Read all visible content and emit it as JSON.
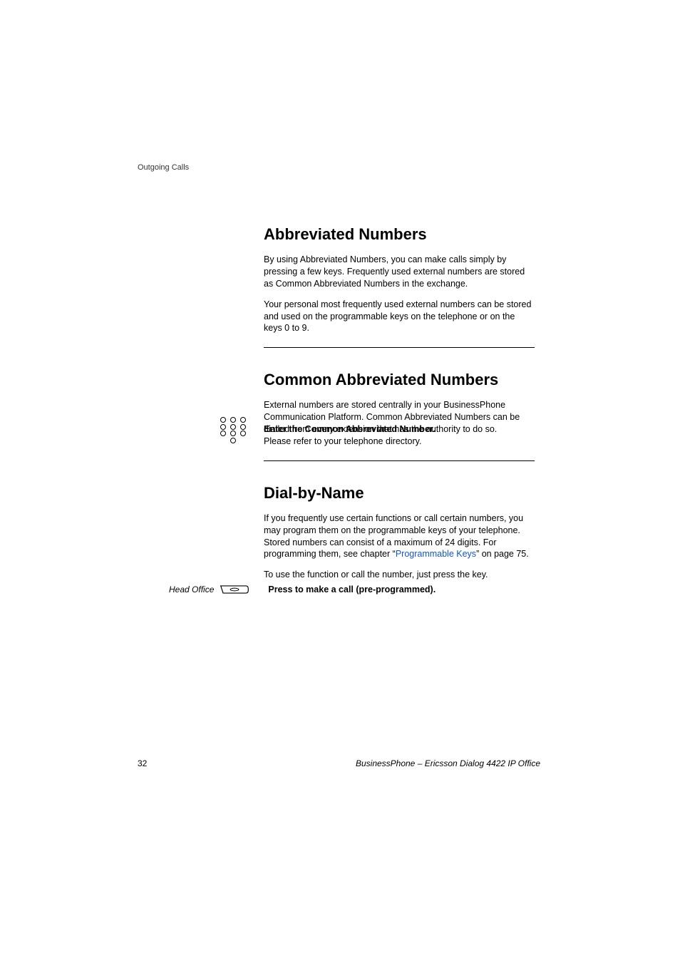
{
  "header": {
    "section_name": "Outgoing Calls"
  },
  "section1": {
    "heading": "Abbreviated Numbers",
    "para1": "By using Abbreviated Numbers, you can make calls simply by pressing a few keys. Frequently used external numbers are stored as Common Abbreviated Numbers in the exchange.",
    "para2": "Your personal most frequently used external numbers can be stored and used on the programmable keys on the telephone or on the keys 0 to 9."
  },
  "section2": {
    "heading": "Common Abbreviated Numbers",
    "para1": "External numbers are stored centrally in your BusinessPhone Communication Platform. Common Abbreviated Numbers can be dialled from every extension that has the authority to do so.",
    "bold_line": "Enter the Common Abbreviated Number.",
    "sub_line": "Please refer to your telephone directory."
  },
  "section3": {
    "heading": "Dial-by-Name",
    "para1_a": "If you frequently use certain functions or call certain numbers, you may program them on the programmable keys of your telephone. Stored numbers can consist of a maximum of 24 digits. For programming them, see chapter “",
    "para1_link": "Programmable Keys",
    "para1_b": "” on page 75.",
    "para2": "To use the function or call the number, just press the key.",
    "key_label": "Head Office",
    "bold_line": "Press to make a call (pre-programmed)."
  },
  "footer": {
    "page_number": "32",
    "doc_title": "BusinessPhone – Ericsson Dialog 4422 IP Office"
  }
}
